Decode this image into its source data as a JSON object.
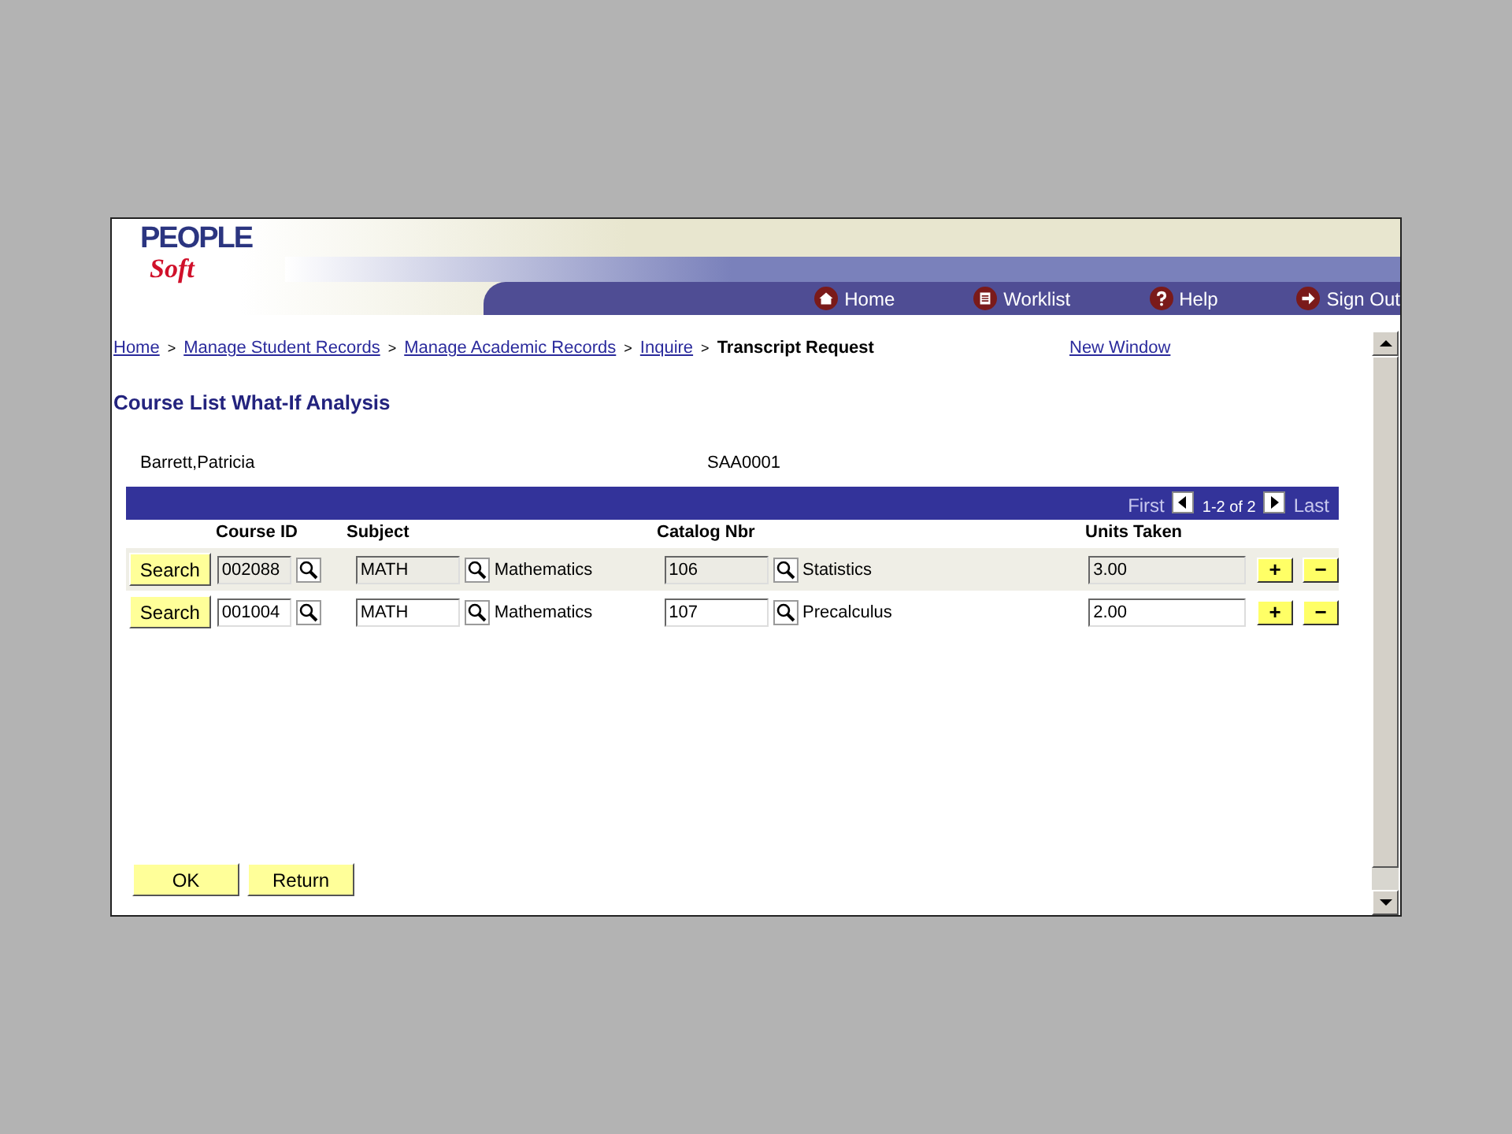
{
  "logo": {
    "top": "PEOPLE",
    "bottom": "Soft"
  },
  "nav": [
    {
      "label": "Home"
    },
    {
      "label": "Worklist"
    },
    {
      "label": "Help"
    },
    {
      "label": "Sign Out"
    }
  ],
  "breadcrumb_separator": ">",
  "breadcrumbs": [
    {
      "label": "Home",
      "kind": "link"
    },
    {
      "label": "Manage Student Records",
      "kind": "link"
    },
    {
      "label": "Manage Academic Records",
      "kind": "link"
    },
    {
      "label": "Inquire",
      "kind": "link"
    },
    {
      "label": "Transcript Request",
      "kind": "current"
    }
  ],
  "new_window": "New Window",
  "page_title": "Course List What-If Analysis",
  "student": {
    "name": "Barrett,Patricia",
    "id": "SAA0001"
  },
  "grid": {
    "first": "First",
    "range": "1-2 of 2",
    "last": "Last",
    "columns": [
      "Course ID",
      "Subject",
      "Catalog Nbr",
      "Units Taken"
    ],
    "rows": [
      {
        "selected": true,
        "search": "Search",
        "course_id": "002088",
        "subject": "MATH",
        "subject_desc": "Mathematics",
        "catalog": "106",
        "catalog_desc": "Statistics",
        "units": "3.00",
        "add": "+",
        "remove": "−"
      },
      {
        "selected": false,
        "search": "Search",
        "course_id": "001004",
        "subject": "MATH",
        "subject_desc": "Mathematics",
        "catalog": "107",
        "catalog_desc": "Precalculus",
        "units": "2.00",
        "add": "+",
        "remove": "−"
      }
    ]
  },
  "buttons": [
    "OK",
    "Return"
  ]
}
